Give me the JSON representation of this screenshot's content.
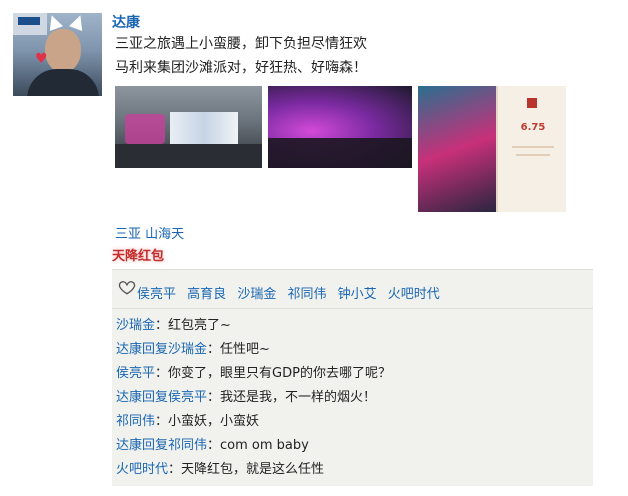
{
  "post": {
    "author": "达康",
    "line1": "三亚之旅遇上小蛮腰，卸下负担尽情狂欢",
    "line2": "马利来集团沙滩派对，好狂热、好嗨森！",
    "photo3_amount": "6.75",
    "location": "三亚 山海天",
    "tag": "天降红包"
  },
  "likes": {
    "icon": "heart-outline-icon",
    "names": [
      "侯亮平",
      "高育良",
      "沙瑞金",
      "祁同伟",
      "钟小艾",
      "火吧时代"
    ]
  },
  "comments": [
    {
      "who": "沙瑞金",
      "text": "：红包亮了~"
    },
    {
      "who": "达康回复沙瑞金",
      "text": "：任性吧~"
    },
    {
      "who": "侯亮平",
      "text": "：你变了，眼里只有GDP的你去哪了呢？"
    },
    {
      "who": "达康回复侯亮平",
      "text": "：我还是我，不一样的烟火！"
    },
    {
      "who": "祁同伟",
      "text": "：小蛮妖，小蛮妖"
    },
    {
      "who": "达康回复祁同伟",
      "text": "：com om baby"
    },
    {
      "who": "火吧时代",
      "text": "：天降红包，就是这么任性"
    }
  ],
  "colors": {
    "link": "#1a66b3",
    "tag": "#c22d2d",
    "panel": "#f1f2ee"
  }
}
